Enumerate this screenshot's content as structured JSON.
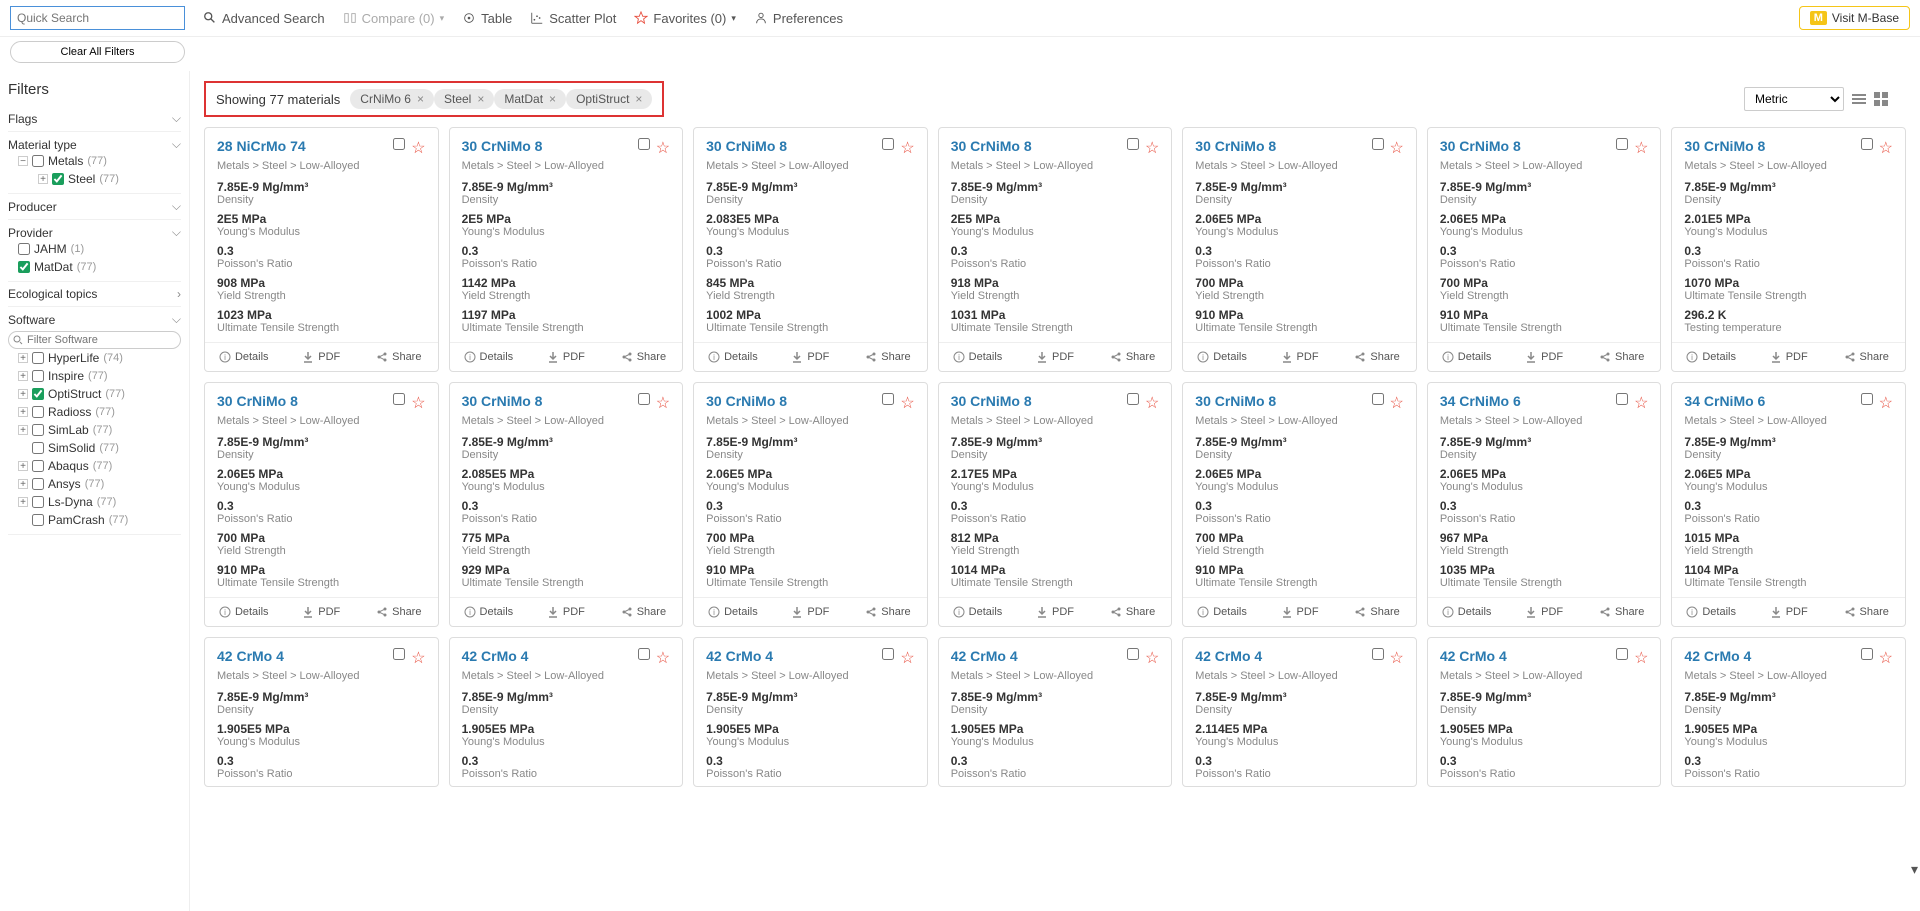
{
  "search_placeholder": "Quick Search",
  "clear_filters": "Clear All Filters",
  "toolbar": {
    "advanced": "Advanced Search",
    "compare": "Compare (0)",
    "table": "Table",
    "scatter": "Scatter Plot",
    "favorites": "Favorites (0)",
    "preferences": "Preferences",
    "visit": "Visit M-Base",
    "visit_badge": "M"
  },
  "filters_title": "Filters",
  "filter_groups": {
    "flags": "Flags",
    "material_type": "Material type",
    "producer": "Producer",
    "provider": "Provider",
    "eco": "Ecological topics",
    "software": "Software"
  },
  "mat_type_tree": {
    "metals": {
      "label": "Metals",
      "count": "(77)"
    },
    "steel": {
      "label": "Steel",
      "count": "(77)"
    }
  },
  "provider_tree": {
    "jahm": {
      "label": "JAHM",
      "count": "(1)"
    },
    "matdat": {
      "label": "MatDat",
      "count": "(77)"
    }
  },
  "software_filter_placeholder": "Filter Software",
  "software_tree": [
    {
      "label": "HyperLife",
      "count": "(74)",
      "exp": true,
      "checked": false
    },
    {
      "label": "Inspire",
      "count": "(77)",
      "exp": true,
      "checked": false
    },
    {
      "label": "OptiStruct",
      "count": "(77)",
      "exp": true,
      "checked": true
    },
    {
      "label": "Radioss",
      "count": "(77)",
      "exp": true,
      "checked": false
    },
    {
      "label": "SimLab",
      "count": "(77)",
      "exp": true,
      "checked": false
    },
    {
      "label": "SimSolid",
      "count": "(77)",
      "exp": false,
      "checked": false
    },
    {
      "label": "Abaqus",
      "count": "(77)",
      "exp": true,
      "checked": false
    },
    {
      "label": "Ansys",
      "count": "(77)",
      "exp": true,
      "checked": false
    },
    {
      "label": "Ls-Dyna",
      "count": "(77)",
      "exp": true,
      "checked": false
    },
    {
      "label": "PamCrash",
      "count": "(77)",
      "exp": false,
      "checked": false
    }
  ],
  "showing": "Showing 77 materials",
  "chips": [
    "CrNiMo 6",
    "Steel",
    "MatDat",
    "OptiStruct"
  ],
  "unit_system": "Metric",
  "crumb": "Metals > Steel > Low-Alloyed",
  "prop_labels": {
    "density": "Density",
    "ym": "Young's Modulus",
    "pr": "Poisson's Ratio",
    "ys": "Yield Strength",
    "uts": "Ultimate Tensile Strength",
    "tt": "Testing temperature"
  },
  "actions": {
    "details": "Details",
    "pdf": "PDF",
    "share": "Share"
  },
  "cards_row1": [
    {
      "title": "28 NiCrMo 74",
      "density": "7.85E-9 Mg/mm³",
      "ym": "2E5 MPa",
      "pr": "0.3",
      "p4": {
        "v": "908 MPa",
        "l": "ys"
      },
      "p5": {
        "v": "1023 MPa",
        "l": "uts"
      }
    },
    {
      "title": "30 CrNiMo 8",
      "density": "7.85E-9 Mg/mm³",
      "ym": "2E5 MPa",
      "pr": "0.3",
      "p4": {
        "v": "1142 MPa",
        "l": "ys"
      },
      "p5": {
        "v": "1197 MPa",
        "l": "uts"
      }
    },
    {
      "title": "30 CrNiMo 8",
      "density": "7.85E-9 Mg/mm³",
      "ym": "2.083E5 MPa",
      "pr": "0.3",
      "p4": {
        "v": "845 MPa",
        "l": "ys"
      },
      "p5": {
        "v": "1002 MPa",
        "l": "uts"
      }
    },
    {
      "title": "30 CrNiMo 8",
      "density": "7.85E-9 Mg/mm³",
      "ym": "2E5 MPa",
      "pr": "0.3",
      "p4": {
        "v": "918 MPa",
        "l": "ys"
      },
      "p5": {
        "v": "1031 MPa",
        "l": "uts"
      }
    },
    {
      "title": "30 CrNiMo 8",
      "density": "7.85E-9 Mg/mm³",
      "ym": "2.06E5 MPa",
      "pr": "0.3",
      "p4": {
        "v": "700 MPa",
        "l": "ys"
      },
      "p5": {
        "v": "910 MPa",
        "l": "uts"
      }
    },
    {
      "title": "30 CrNiMo 8",
      "density": "7.85E-9 Mg/mm³",
      "ym": "2.06E5 MPa",
      "pr": "0.3",
      "p4": {
        "v": "700 MPa",
        "l": "ys"
      },
      "p5": {
        "v": "910 MPa",
        "l": "uts"
      }
    },
    {
      "title": "30 CrNiMo 8",
      "density": "7.85E-9 Mg/mm³",
      "ym": "2.01E5 MPa",
      "pr": "0.3",
      "p4": {
        "v": "1070 MPa",
        "l": "uts"
      },
      "p5": {
        "v": "296.2 K",
        "l": "tt"
      }
    }
  ],
  "cards_row2": [
    {
      "title": "30 CrNiMo 8",
      "density": "7.85E-9 Mg/mm³",
      "ym": "2.06E5 MPa",
      "pr": "0.3",
      "p4": {
        "v": "700 MPa",
        "l": "ys"
      },
      "p5": {
        "v": "910 MPa",
        "l": "uts"
      }
    },
    {
      "title": "30 CrNiMo 8",
      "density": "7.85E-9 Mg/mm³",
      "ym": "2.085E5 MPa",
      "pr": "0.3",
      "p4": {
        "v": "775 MPa",
        "l": "ys"
      },
      "p5": {
        "v": "929 MPa",
        "l": "uts"
      }
    },
    {
      "title": "30 CrNiMo 8",
      "density": "7.85E-9 Mg/mm³",
      "ym": "2.06E5 MPa",
      "pr": "0.3",
      "p4": {
        "v": "700 MPa",
        "l": "ys"
      },
      "p5": {
        "v": "910 MPa",
        "l": "uts"
      }
    },
    {
      "title": "30 CrNiMo 8",
      "density": "7.85E-9 Mg/mm³",
      "ym": "2.17E5 MPa",
      "pr": "0.3",
      "p4": {
        "v": "812 MPa",
        "l": "ys"
      },
      "p5": {
        "v": "1014 MPa",
        "l": "uts"
      }
    },
    {
      "title": "30 CrNiMo 8",
      "density": "7.85E-9 Mg/mm³",
      "ym": "2.06E5 MPa",
      "pr": "0.3",
      "p4": {
        "v": "700 MPa",
        "l": "ys"
      },
      "p5": {
        "v": "910 MPa",
        "l": "uts"
      }
    },
    {
      "title": "34 CrNiMo 6",
      "density": "7.85E-9 Mg/mm³",
      "ym": "2.06E5 MPa",
      "pr": "0.3",
      "p4": {
        "v": "967 MPa",
        "l": "ys"
      },
      "p5": {
        "v": "1035 MPa",
        "l": "uts"
      }
    },
    {
      "title": "34 CrNiMo 6",
      "density": "7.85E-9 Mg/mm³",
      "ym": "2.06E5 MPa",
      "pr": "0.3",
      "p4": {
        "v": "1015 MPa",
        "l": "ys"
      },
      "p5": {
        "v": "1104 MPa",
        "l": "uts"
      }
    }
  ],
  "cards_row3": [
    {
      "title": "42 CrMo 4",
      "density": "7.85E-9 Mg/mm³",
      "ym": "1.905E5 MPa",
      "pr": "0.3"
    },
    {
      "title": "42 CrMo 4",
      "density": "7.85E-9 Mg/mm³",
      "ym": "1.905E5 MPa",
      "pr": "0.3"
    },
    {
      "title": "42 CrMo 4",
      "density": "7.85E-9 Mg/mm³",
      "ym": "1.905E5 MPa",
      "pr": "0.3"
    },
    {
      "title": "42 CrMo 4",
      "density": "7.85E-9 Mg/mm³",
      "ym": "1.905E5 MPa",
      "pr": "0.3"
    },
    {
      "title": "42 CrMo 4",
      "density": "7.85E-9 Mg/mm³",
      "ym": "2.114E5 MPa",
      "pr": "0.3"
    },
    {
      "title": "42 CrMo 4",
      "density": "7.85E-9 Mg/mm³",
      "ym": "1.905E5 MPa",
      "pr": "0.3"
    },
    {
      "title": "42 CrMo 4",
      "density": "7.85E-9 Mg/mm³",
      "ym": "1.905E5 MPa",
      "pr": "0.3"
    }
  ]
}
